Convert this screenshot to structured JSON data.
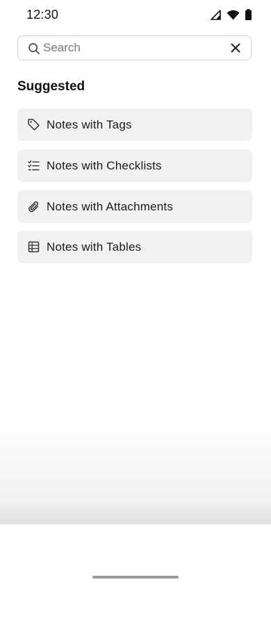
{
  "status_bar": {
    "time": "12:30",
    "icons": [
      "signal-icon",
      "wifi-icon",
      "battery-icon"
    ]
  },
  "search": {
    "placeholder": "Search",
    "value": "",
    "clear_icon": "close-icon"
  },
  "section": {
    "title": "Suggested"
  },
  "suggestions": [
    {
      "label": "Notes with Tags",
      "icon": "tag-icon"
    },
    {
      "label": "Notes with Checklists",
      "icon": "checklist-icon"
    },
    {
      "label": "Notes with Attachments",
      "icon": "paperclip-icon"
    },
    {
      "label": "Notes with Tables",
      "icon": "table-icon"
    }
  ]
}
